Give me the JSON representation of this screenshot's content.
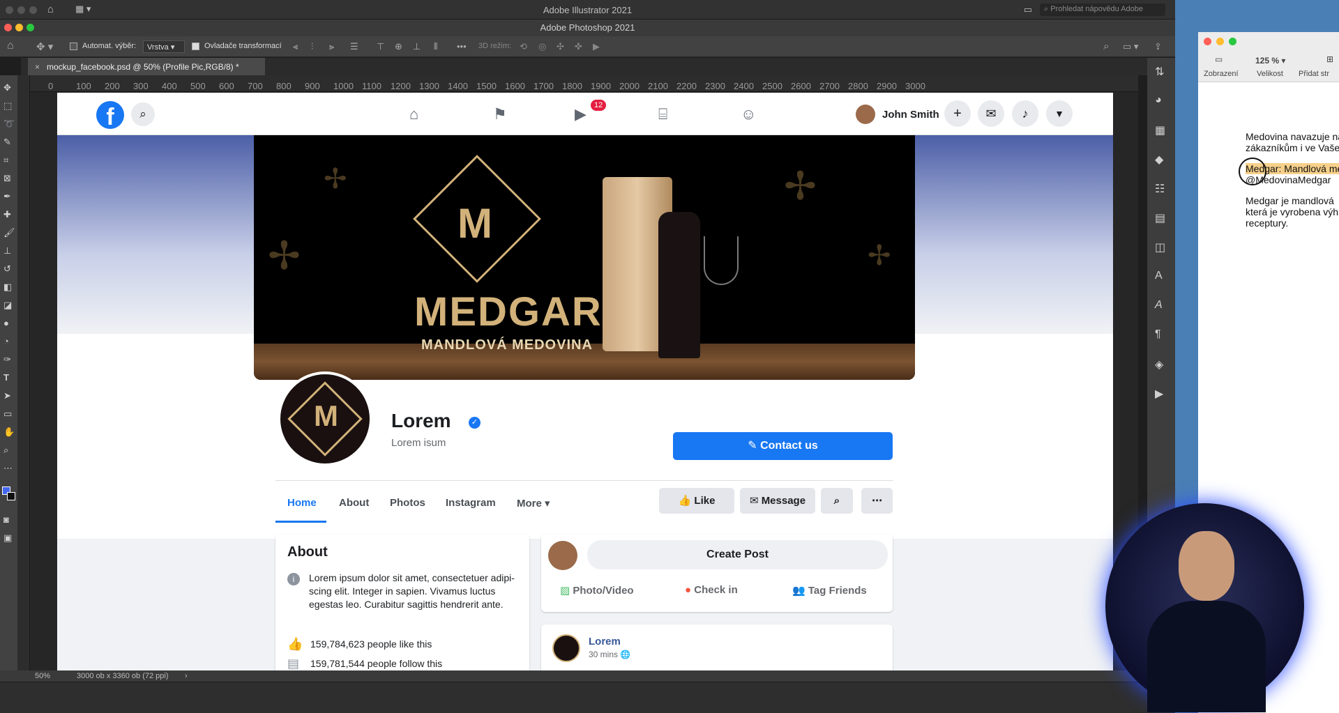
{
  "illustrator": {
    "title": "Adobe Illustrator 2021",
    "search_placeholder": "Prohledat nápovědu Adobe"
  },
  "photoshop": {
    "title": "Adobe Photoshop 2021"
  },
  "options_bar": {
    "auto_select_label": "Automat. výběr:",
    "auto_select_value": "Vrstva",
    "transform_label": "Ovladače transformací",
    "mode_3d": "3D režim:"
  },
  "document_tab": {
    "name": "mockup_facebook.psd @ 50% (Profile Pic,RGB/8) *"
  },
  "ruler": {
    "marks": [
      "0",
      "100",
      "200",
      "300",
      "400",
      "500",
      "600",
      "700",
      "800",
      "900",
      "1000",
      "1100",
      "1200",
      "1300",
      "1400",
      "1500",
      "1600",
      "1700",
      "1800",
      "1900",
      "2000",
      "2100",
      "2200",
      "2300",
      "2400",
      "2500",
      "2600",
      "2700",
      "2800",
      "2900",
      "3000"
    ]
  },
  "facebook": {
    "user_name": "John Smith",
    "video_badge": "12",
    "cover_brand": "MEDGAR",
    "cover_sub": "MANDLOVÁ MEDOVINA",
    "page_name": "Lorem",
    "page_sub": "Lorem isum",
    "contact_button": "Contact us",
    "tabs": [
      "Home",
      "About",
      "Photos",
      "Instagram",
      "More"
    ],
    "like_button": "Like",
    "message_button": "Message",
    "about": {
      "title": "About",
      "text": "Lorem ipsum dolor sit amet, consectetuer adipi-scing elit. Integer in sapien. Vivamus luctus egestas leo. Curabitur sagittis hendrerit ante.",
      "likes": "159,784,623 people like this",
      "follows": "159,781,544 people follow this"
    },
    "create_post": {
      "button": "Create Post",
      "photo_video": "Photo/Video",
      "check_in": "Check in",
      "tag_friends": "Tag Friends"
    },
    "post": {
      "author": "Lorem",
      "time": "30 mins"
    }
  },
  "statusbar": {
    "zoom": "50%",
    "doc_size": "3000 ob x 3360 ob (72 ppi)"
  },
  "word_doc": {
    "zoom": "125 %",
    "toolbar": [
      "Zobrazení",
      "Velikost",
      "Přidat str"
    ],
    "lines": [
      "Medovina navazuje na",
      "zákazníkům i ve Vaše",
      "Medgar: Mandlová me",
      "@MedovinaMedgar",
      "Medgar je mandlová",
      "která je vyrobena výh",
      "receptury."
    ]
  }
}
